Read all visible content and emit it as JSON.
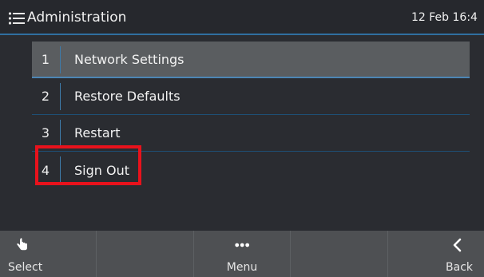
{
  "header": {
    "title": "Administration",
    "time": "12 Feb 16:4"
  },
  "menu": {
    "items": [
      {
        "number": "1",
        "label": "Network Settings",
        "selected": true
      },
      {
        "number": "2",
        "label": "Restore Defaults",
        "selected": false
      },
      {
        "number": "3",
        "label": "Restart",
        "selected": false
      },
      {
        "number": "4",
        "label": "Sign Out",
        "selected": false
      }
    ]
  },
  "softkeys": [
    {
      "label": "Select",
      "icon": "hand-pointer-icon"
    },
    {
      "label": "",
      "icon": ""
    },
    {
      "label": "Menu",
      "icon": "more-dots-icon"
    },
    {
      "label": "",
      "icon": ""
    },
    {
      "label": "Back",
      "icon": "chevron-left-icon"
    }
  ],
  "colors": {
    "background": "#2a2c31",
    "selected_row": "#5a5d60",
    "accent_blue": "#3e7aa8",
    "highlight_red": "#e8121c",
    "softkey_bar": "#4e5053"
  }
}
